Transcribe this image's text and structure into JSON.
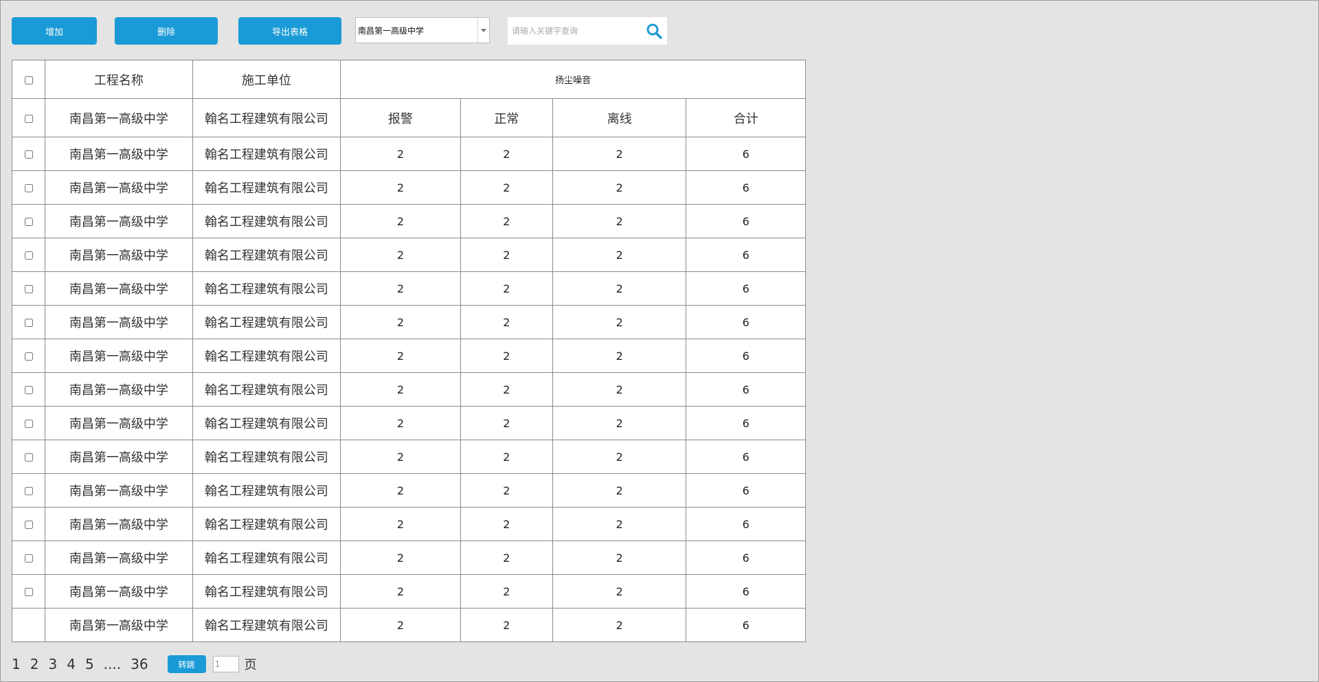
{
  "toolbar": {
    "add_label": "增加",
    "delete_label": "删除",
    "export_label": "导出表格",
    "project_select_value": "南昌第一高级中学",
    "search_placeholder": "请输入关键字查询"
  },
  "table": {
    "headers": {
      "project_name": "工程名称",
      "construction_unit": "施工单位",
      "group": "扬尘噪音"
    },
    "second_header": {
      "project_name": "南昌第一高级中学",
      "construction_unit": "翰名工程建筑有限公司",
      "alarm": "报警",
      "normal": "正常",
      "offline": "离线",
      "total": "合计"
    },
    "rows": [
      {
        "project": "南昌第一高级中学",
        "unit": "翰名工程建筑有限公司",
        "alarm": "2",
        "normal": "2",
        "offline": "2",
        "total": "6"
      },
      {
        "project": "南昌第一高级中学",
        "unit": "翰名工程建筑有限公司",
        "alarm": "2",
        "normal": "2",
        "offline": "2",
        "total": "6"
      },
      {
        "project": "南昌第一高级中学",
        "unit": "翰名工程建筑有限公司",
        "alarm": "2",
        "normal": "2",
        "offline": "2",
        "total": "6"
      },
      {
        "project": "南昌第一高级中学",
        "unit": "翰名工程建筑有限公司",
        "alarm": "2",
        "normal": "2",
        "offline": "2",
        "total": "6"
      },
      {
        "project": "南昌第一高级中学",
        "unit": "翰名工程建筑有限公司",
        "alarm": "2",
        "normal": "2",
        "offline": "2",
        "total": "6"
      },
      {
        "project": "南昌第一高级中学",
        "unit": "翰名工程建筑有限公司",
        "alarm": "2",
        "normal": "2",
        "offline": "2",
        "total": "6"
      },
      {
        "project": "南昌第一高级中学",
        "unit": "翰名工程建筑有限公司",
        "alarm": "2",
        "normal": "2",
        "offline": "2",
        "total": "6"
      },
      {
        "project": "南昌第一高级中学",
        "unit": "翰名工程建筑有限公司",
        "alarm": "2",
        "normal": "2",
        "offline": "2",
        "total": "6"
      },
      {
        "project": "南昌第一高级中学",
        "unit": "翰名工程建筑有限公司",
        "alarm": "2",
        "normal": "2",
        "offline": "2",
        "total": "6"
      },
      {
        "project": "南昌第一高级中学",
        "unit": "翰名工程建筑有限公司",
        "alarm": "2",
        "normal": "2",
        "offline": "2",
        "total": "6"
      },
      {
        "project": "南昌第一高级中学",
        "unit": "翰名工程建筑有限公司",
        "alarm": "2",
        "normal": "2",
        "offline": "2",
        "total": "6"
      },
      {
        "project": "南昌第一高级中学",
        "unit": "翰名工程建筑有限公司",
        "alarm": "2",
        "normal": "2",
        "offline": "2",
        "total": "6"
      },
      {
        "project": "南昌第一高级中学",
        "unit": "翰名工程建筑有限公司",
        "alarm": "2",
        "normal": "2",
        "offline": "2",
        "total": "6"
      },
      {
        "project": "南昌第一高级中学",
        "unit": "翰名工程建筑有限公司",
        "alarm": "2",
        "normal": "2",
        "offline": "2",
        "total": "6"
      },
      {
        "project": "南昌第一高级中学",
        "unit": "翰名工程建筑有限公司",
        "alarm": "2",
        "normal": "2",
        "offline": "2",
        "total": "6"
      }
    ]
  },
  "pager": {
    "pages": [
      "1",
      "2",
      "3",
      "4",
      "5",
      "....",
      "36"
    ],
    "go_label": "转跳",
    "page_input_value": "1",
    "page_suffix": "页"
  },
  "colors": {
    "accent": "#1a9ad6",
    "background": "#e4e4e4",
    "border": "#8a8a8a"
  }
}
